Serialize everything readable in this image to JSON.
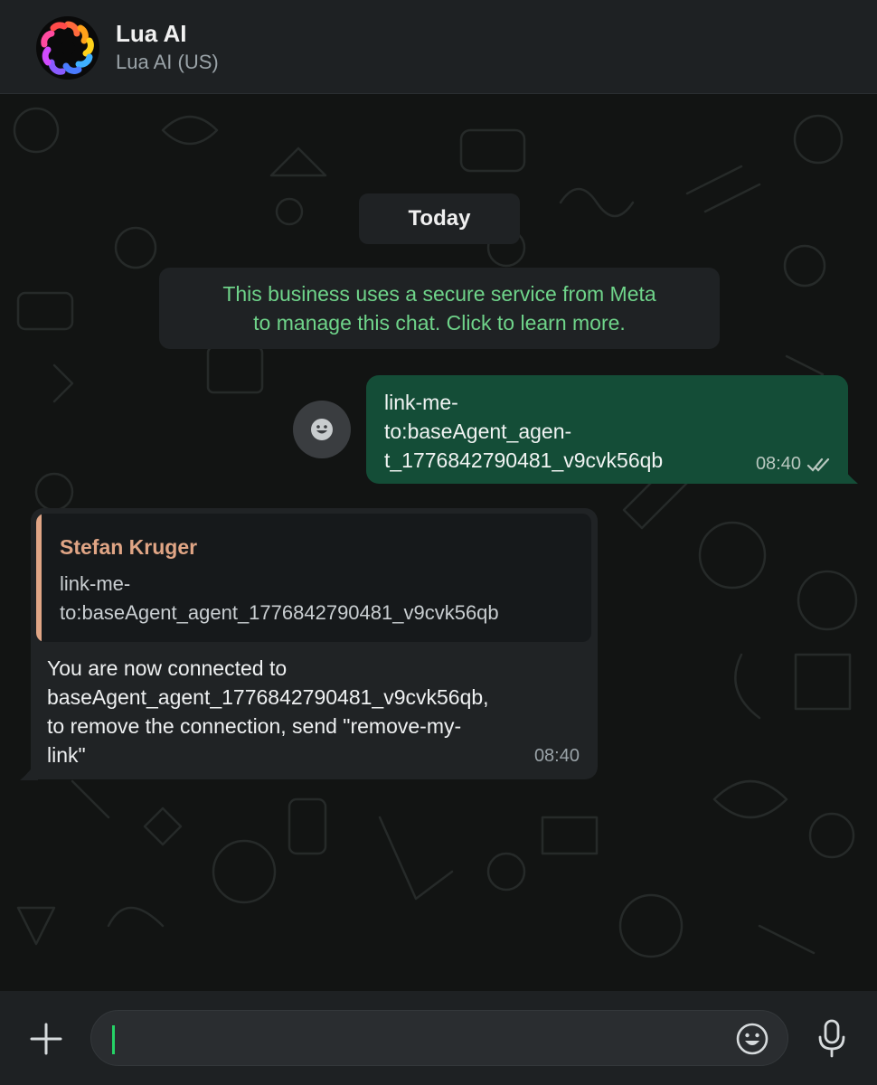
{
  "header": {
    "title": "Lua AI",
    "subtitle": "Lua AI (US)"
  },
  "chat": {
    "date_label": "Today",
    "notice": "This business uses a secure service from Meta\nto manage this chat. Click to learn more.",
    "outgoing": {
      "text": "link-me-\nto:baseAgent_agen-\nt_1776842790481_v9cvk56qb",
      "time": "08:40",
      "status_icon": "double-check-icon"
    },
    "incoming": {
      "quote_author": "Stefan Kruger",
      "quote_text": "link-me-\nto:baseAgent_agent_1776842790481_v9cvk56qb",
      "text": "You are now connected to\nbaseAgent_agent_1776842790481_v9cvk56qb,\nto remove the connection, send \"remove-my-\nlink\"",
      "time": "08:40"
    }
  },
  "composer": {
    "value": "",
    "icons": [
      "plus-icon",
      "emoji-icon",
      "microphone-icon"
    ]
  },
  "colors": {
    "header_bg": "#1e2123",
    "chat_bg": "#121413",
    "outgoing_bubble": "#144d37",
    "incoming_bubble": "#202325",
    "notice_text": "#6fd48a",
    "quote_accent": "#e0a585",
    "caret": "#25d366"
  }
}
